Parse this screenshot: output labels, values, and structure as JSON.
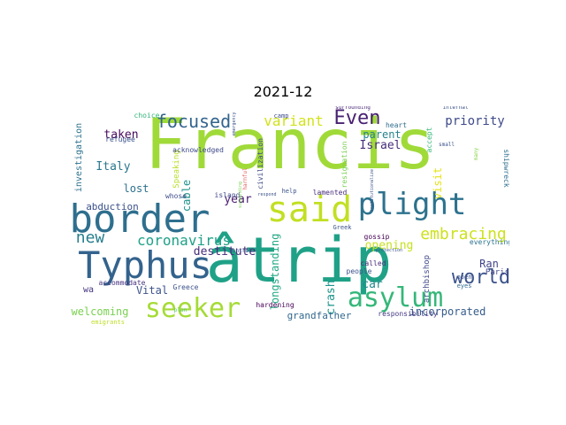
{
  "title": "2021-12",
  "words": [
    {
      "text": "Francis",
      "color": "#a0da39"
    },
    {
      "text": "âtrip",
      "color": "#1fa187"
    },
    {
      "text": "border",
      "color": "#2e6f8e"
    },
    {
      "text": "Typhus",
      "color": "#33638d"
    },
    {
      "text": "said",
      "color": "#c2df23"
    },
    {
      "text": "plight",
      "color": "#2c728e"
    },
    {
      "text": "asylum",
      "color": "#35b779"
    },
    {
      "text": "seeker",
      "color": "#a5db36"
    },
    {
      "text": "focused",
      "color": "#32648e"
    },
    {
      "text": "Even",
      "color": "#482173"
    },
    {
      "text": "world",
      "color": "#3b528b"
    },
    {
      "text": "coronavirus",
      "color": "#1fa188"
    },
    {
      "text": "embracing",
      "color": "#cde11d"
    },
    {
      "text": "new",
      "color": "#277f8e"
    },
    {
      "text": "variant",
      "color": "#d2e21b"
    },
    {
      "text": "priority",
      "color": "#3e4a89"
    },
    {
      "text": "Israel",
      "color": "#472d7b"
    },
    {
      "text": "parent",
      "color": "#26828e"
    },
    {
      "text": "opening",
      "color": "#c8e020"
    },
    {
      "text": "crash",
      "color": "#1f958b"
    },
    {
      "text": "car",
      "color": "#23898e"
    },
    {
      "text": "Ran",
      "color": "#414487"
    },
    {
      "text": "taken",
      "color": "#46085c"
    },
    {
      "text": "Italy",
      "color": "#2a788e"
    },
    {
      "text": "lost",
      "color": "#2d708e"
    },
    {
      "text": "abduction",
      "color": "#3b518b"
    },
    {
      "text": "destitute",
      "color": "#472c7a"
    },
    {
      "text": "year",
      "color": "#481b6d"
    },
    {
      "text": "longstanding",
      "color": "#22a884"
    },
    {
      "text": "welcoming",
      "color": "#7ad151"
    },
    {
      "text": "Vital",
      "color": "#3b528b"
    },
    {
      "text": "grandfather",
      "color": "#31688e"
    },
    {
      "text": "incorporated",
      "color": "#365c8d"
    },
    {
      "text": "visit",
      "color": "#e5e419"
    },
    {
      "text": "cable",
      "color": "#20928c"
    },
    {
      "text": "investigation",
      "color": "#2c728e"
    },
    {
      "text": "wa",
      "color": "#453581"
    },
    {
      "text": "Speaking",
      "color": "#b8de29"
    },
    {
      "text": "acknowledged",
      "color": "#3e4989"
    },
    {
      "text": "choice",
      "color": "#31b57b"
    },
    {
      "text": "refugee",
      "color": "#3b528b"
    },
    {
      "text": "island",
      "color": "#404688"
    },
    {
      "text": "whose",
      "color": "#3e4c8a"
    },
    {
      "text": "accommodate",
      "color": "#46337f"
    },
    {
      "text": "Greece",
      "color": "#3b528b"
    },
    {
      "text": "emigrants",
      "color": "#bddf26"
    },
    {
      "text": "plan",
      "color": "#56c667"
    },
    {
      "text": "Paris",
      "color": "#3f4788"
    },
    {
      "text": "responsibility",
      "color": "#453781"
    },
    {
      "text": "people",
      "color": "#3b528b"
    },
    {
      "text": "called",
      "color": "#472a7a"
    },
    {
      "text": "gossip",
      "color": "#440154"
    },
    {
      "text": "hardening",
      "color": "#440154"
    },
    {
      "text": "archbishop",
      "color": "#3f4889"
    },
    {
      "text": "shipwreck",
      "color": "#2e6e8e"
    },
    {
      "text": "everything",
      "color": "#2c738e"
    },
    {
      "text": "accept",
      "color": "#35b779"
    },
    {
      "text": "heart",
      "color": "#2f6c8e"
    },
    {
      "text": "civilization",
      "color": "#3e4989"
    },
    {
      "text": "resignation",
      "color": "#7ad151"
    },
    {
      "text": "Greek",
      "color": "#3b528b"
    },
    {
      "text": "lamented",
      "color": "#472d7b"
    },
    {
      "text": "help",
      "color": "#3b528b"
    },
    {
      "text": "internal",
      "color": "#3b528b"
    },
    {
      "text": "surrounding",
      "color": "#482475"
    },
    {
      "text": "camp",
      "color": "#3e4989"
    },
    {
      "text": "many",
      "color": "#86d549"
    },
    {
      "text": "small",
      "color": "#3b528b"
    },
    {
      "text": "open",
      "color": "#3b528b"
    },
    {
      "text": "eyes",
      "color": "#31688e"
    },
    {
      "text": "control",
      "color": "#3b528b"
    },
    {
      "text": "harmful",
      "color": "#e16462"
    },
    {
      "text": "suspending",
      "color": "#7ad151"
    },
    {
      "text": "respond",
      "color": "#3b528b"
    },
    {
      "text": "institutionalize",
      "color": "#3b528b"
    },
    {
      "text": "protection",
      "color": "#3b528b"
    },
    {
      "text": "emergency",
      "color": "#3b528b"
    }
  ]
}
